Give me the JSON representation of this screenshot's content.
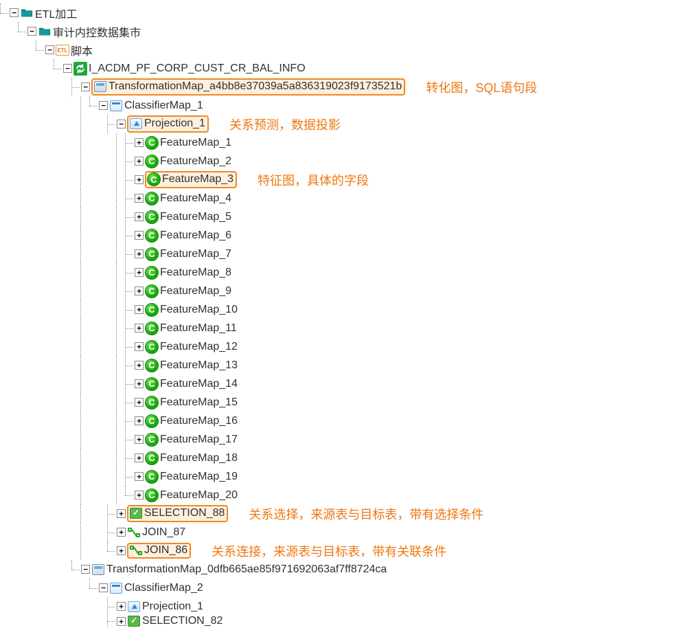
{
  "tree": {
    "root": "ETL加工",
    "node1": "审计内控数据集市",
    "node2": "脚本",
    "node2_icon": "ETL",
    "node3": "I_ACDM_PF_CORP_CUST_CR_BAL_INFO",
    "tmap1": "TransformationMap_a4bb8e37039a5a836319023f9173521b",
    "cmap1": "ClassifierMap_1",
    "proj1": "Projection_1",
    "features": [
      "FeatureMap_1",
      "FeatureMap_2",
      "FeatureMap_3",
      "FeatureMap_4",
      "FeatureMap_5",
      "FeatureMap_6",
      "FeatureMap_7",
      "FeatureMap_8",
      "FeatureMap_9",
      "FeatureMap_10",
      "FeatureMap_11",
      "FeatureMap_12",
      "FeatureMap_13",
      "FeatureMap_14",
      "FeatureMap_15",
      "FeatureMap_16",
      "FeatureMap_17",
      "FeatureMap_18",
      "FeatureMap_19",
      "FeatureMap_20"
    ],
    "sel88": "SELECTION_88",
    "join87": "JOIN_87",
    "join86": "JOIN_86",
    "tmap2": "TransformationMap_0dfb665ae85f971692063af7ff8724ca",
    "cmap2": "ClassifierMap_2",
    "proj2": "Projection_1",
    "sel82": "SELECTION_82"
  },
  "annotations": {
    "tmap": "转化图，SQL语句段",
    "proj": "关系预测，数据投影",
    "fmap": "特征图，具体的字段",
    "sel": "关系选择，来源表与目标表，带有选择条件",
    "join": "关系连接，来源表与目标表，带有关联条件"
  },
  "glyphs": {
    "plus": "+",
    "minus": "−",
    "c": "C"
  }
}
